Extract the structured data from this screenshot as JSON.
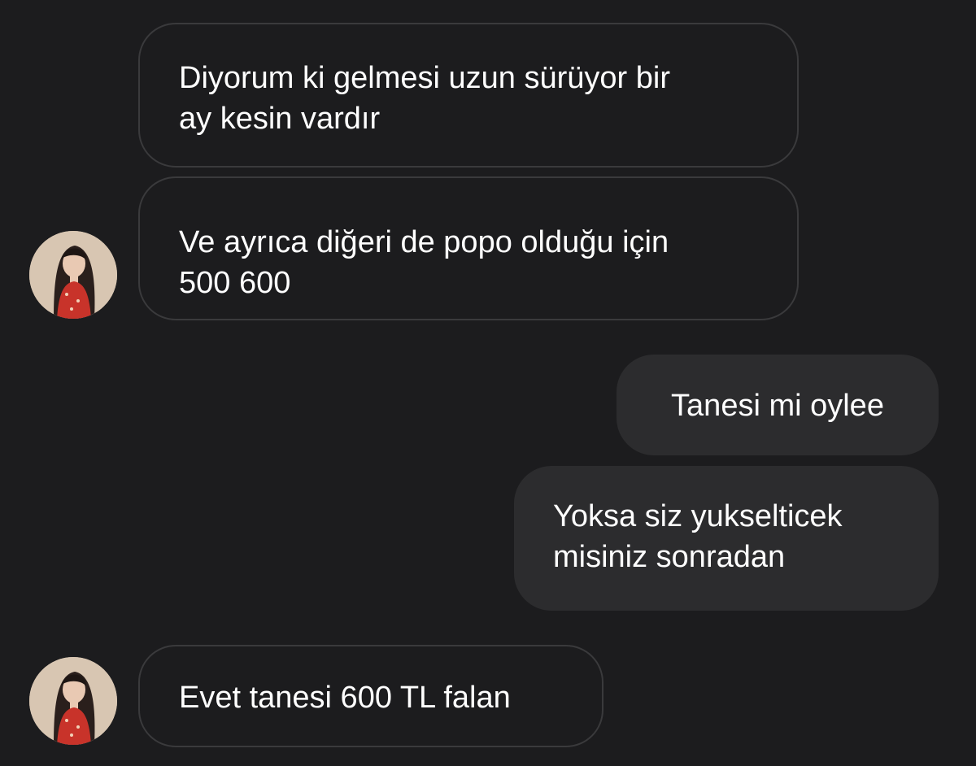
{
  "conversation": {
    "messages": [
      {
        "direction": "received",
        "text": "Diyorum ki gelmesi uzun sürüyor bir\nay kesin vardır"
      },
      {
        "direction": "received",
        "text": "Ve ayrıca diğeri de popo olduğu için\n500 600"
      },
      {
        "direction": "sent",
        "text": "Tanesi mi oylee"
      },
      {
        "direction": "sent",
        "text": "Yoksa siz yukselticek\nmisiniz sonradan"
      },
      {
        "direction": "received",
        "text": "Evet tanesi 600 TL falan"
      }
    ]
  },
  "colors": {
    "background": "#1c1c1e",
    "sent_bubble": "#2c2c2e",
    "received_border": "#3a3a3c",
    "text": "#ffffff"
  },
  "icons": {
    "avatar": "contact-avatar-photo"
  }
}
